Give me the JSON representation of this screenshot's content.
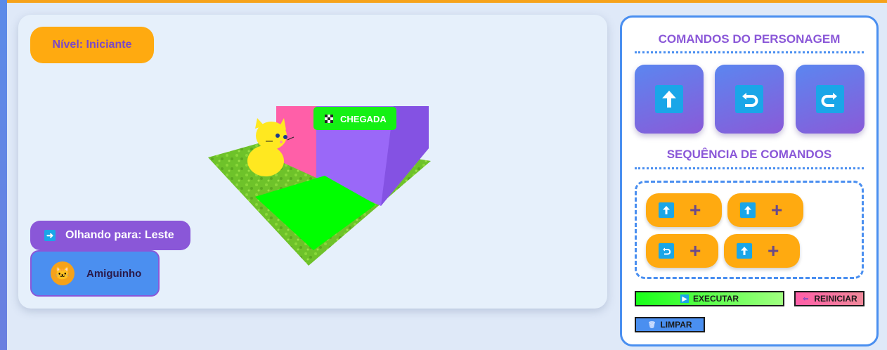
{
  "level": {
    "label": "Nível: Iniciante"
  },
  "scene": {
    "finish_label": "CHEGADA"
  },
  "status": {
    "facing_label": "Olhando para: Leste"
  },
  "character": {
    "name": "Amiguinho"
  },
  "commands": {
    "title": "COMANDOS DO PERSONAGEM",
    "buttons": [
      {
        "icon": "arrow-up-icon"
      },
      {
        "icon": "turn-left-icon"
      },
      {
        "icon": "turn-right-icon"
      }
    ]
  },
  "sequence": {
    "title": "SEQUÊNCIA DE COMANDOS",
    "items": [
      {
        "icon": "arrow-up-icon",
        "plus": "+"
      },
      {
        "icon": "arrow-up-icon",
        "plus": "+"
      },
      {
        "icon": "turn-left-icon",
        "plus": "+"
      },
      {
        "icon": "arrow-up-icon",
        "plus": "+"
      }
    ]
  },
  "actions": {
    "execute_label": "EXECUTAR",
    "restart_label": "REINICIAR",
    "clear_label": "LIMPAR"
  },
  "colors": {
    "accent_orange": "#ffaa10",
    "accent_purple": "#8a57d8",
    "accent_blue": "#4a8ff0",
    "execute_green": "#19ff19",
    "restart_pink": "#f07890"
  }
}
